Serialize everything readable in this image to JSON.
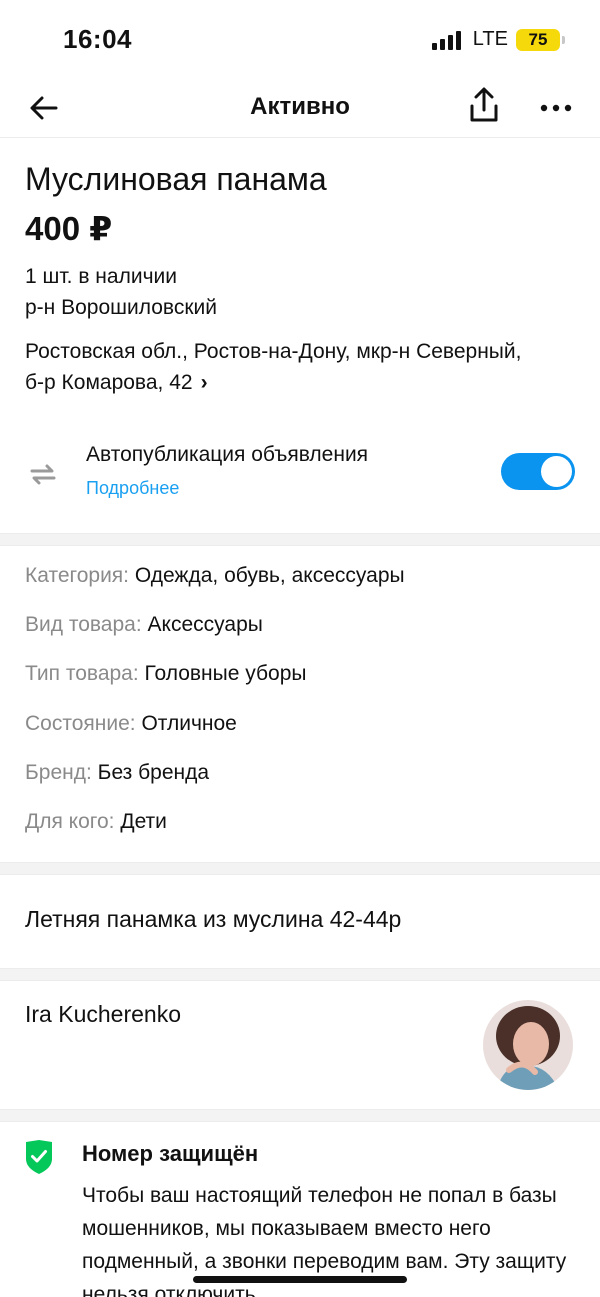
{
  "status_bar": {
    "time": "16:04",
    "network": "LTE",
    "battery": "75"
  },
  "nav": {
    "title": "Активно",
    "back_icon": "arrow-left-icon",
    "share_icon": "share-icon",
    "more_icon": "more-dots-icon"
  },
  "listing": {
    "title": "Муслиновая панама",
    "price": "400 ₽",
    "stock": "1 шт. в наличии",
    "district": "р-н Ворошиловский",
    "address": "Ростовская обл., Ростов-на-Дону, мкр-н Северный, б-р Комарова, 42",
    "address_chevron": "›"
  },
  "autopublish": {
    "label": "Автопубликация объявления",
    "link": "Подробнее",
    "enabled": true,
    "accent_color": "#0a94ef",
    "link_color": "#1aa0f0"
  },
  "params": [
    {
      "key": "Категория:",
      "value": "Одежда, обувь, аксессуары"
    },
    {
      "key": "Вид товара:",
      "value": "Аксессуары"
    },
    {
      "key": "Тип товара:",
      "value": "Головные уборы"
    },
    {
      "key": "Состояние:",
      "value": "Отличное"
    },
    {
      "key": "Бренд:",
      "value": "Без бренда"
    },
    {
      "key": "Для кого:",
      "value": "Дети"
    }
  ],
  "description": "Летняя панамка из муслина 42-44р",
  "seller": {
    "name": "Ira Kucherenko"
  },
  "secure": {
    "title": "Номер защищён",
    "text": "Чтобы ваш настоящий телефон не попал в базы мошенников, мы показываем вместо него подменный, а звонки переводим вам. Эту защиту нельзя отключить.",
    "icon_color": "#04c85a"
  }
}
